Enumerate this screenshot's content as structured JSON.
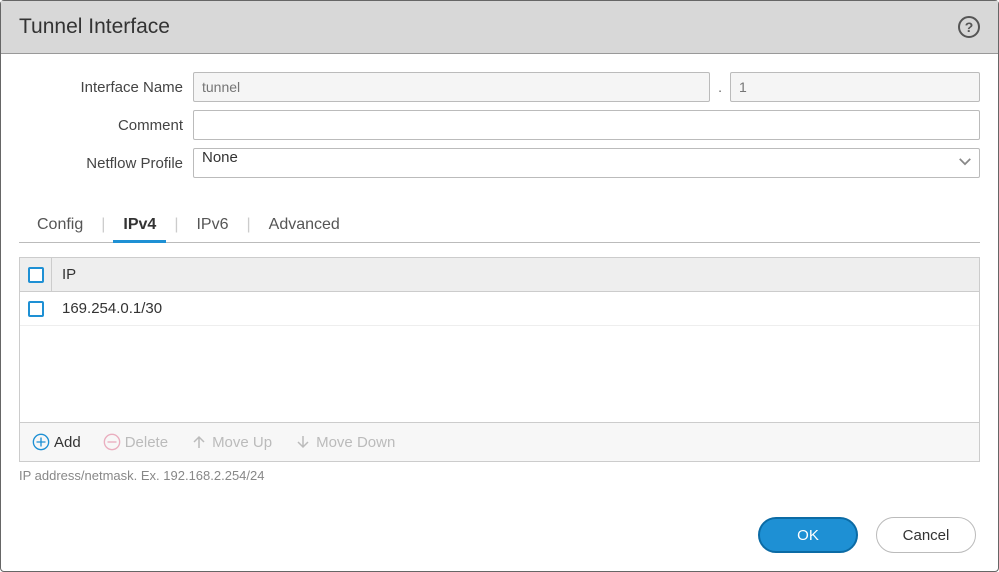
{
  "title": "Tunnel Interface",
  "form": {
    "interface_name_label": "Interface Name",
    "interface_name_placeholder": "tunnel",
    "interface_number_placeholder": "1",
    "comment_label": "Comment",
    "comment_value": "",
    "netflow_label": "Netflow Profile",
    "netflow_value": "None"
  },
  "tabs": {
    "config": "Config",
    "ipv4": "IPv4",
    "ipv6": "IPv6",
    "advanced": "Advanced"
  },
  "table": {
    "header_ip": "IP",
    "rows": [
      {
        "ip": "169.254.0.1/30"
      }
    ]
  },
  "actions": {
    "add": "Add",
    "delete": "Delete",
    "move_up": "Move Up",
    "move_down": "Move Down"
  },
  "hint": "IP address/netmask. Ex. 192.168.2.254/24",
  "buttons": {
    "ok": "OK",
    "cancel": "Cancel"
  }
}
